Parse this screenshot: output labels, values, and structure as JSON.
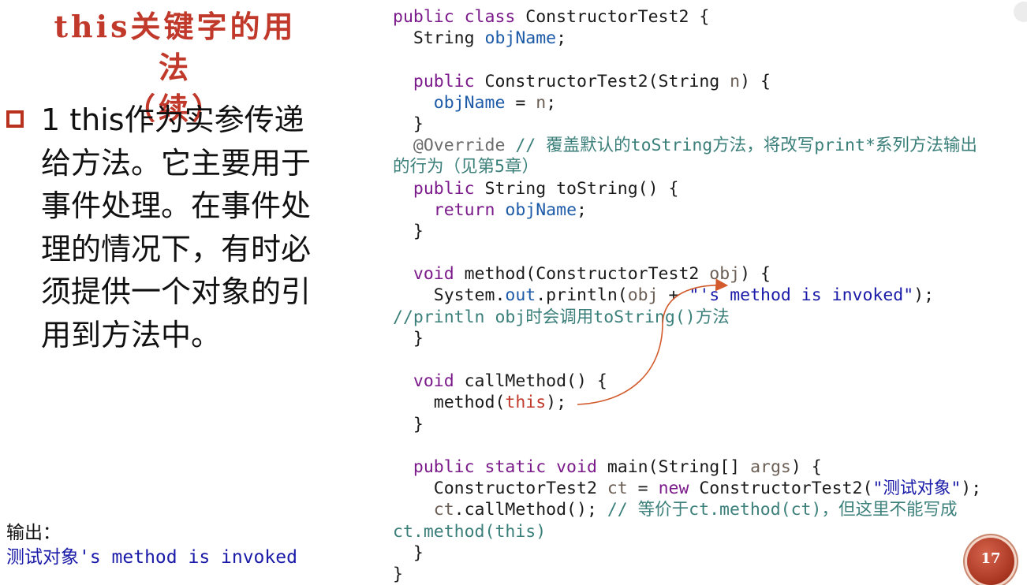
{
  "slide": {
    "title_line1": "this关键字的用法",
    "title_line2": "（续）",
    "bullet_text": "1 this作为实参传递给方法。它主要用于事件处理。在事件处理的情况下，有时必须提供一个对象的引用到方法中。",
    "page_number": "17"
  },
  "code": {
    "lines": {
      "l01": [
        "public class ",
        "ConstructorTest2 {"
      ],
      "l02": [
        "  String ",
        "objName",
        ";"
      ],
      "l04": [
        "  ",
        "public",
        " ConstructorTest2(String ",
        "n",
        ") {"
      ],
      "l05": [
        "    ",
        "objName",
        " = ",
        "n",
        ";"
      ],
      "l06": "  }",
      "l07": [
        "  ",
        "@Override",
        " // 覆盖默认的toString方法，将改写print*系列方法输出"
      ],
      "l08": "的行为（见第5章）",
      "l09": [
        "  ",
        "public",
        " String toString() {"
      ],
      "l10": [
        "    ",
        "return",
        " ",
        "objName",
        ";"
      ],
      "l11": "  }",
      "l13": [
        "  ",
        "void",
        " method(ConstructorTest2 ",
        "obj",
        ") {"
      ],
      "l14": [
        "    System.",
        "out",
        ".println(",
        "obj",
        " + ",
        "\"'s method is invoked\"",
        ");"
      ],
      "l15": "//println obj时会调用toString()方法",
      "l16": "  }",
      "l18": [
        "  ",
        "void",
        " callMethod() {"
      ],
      "l19": [
        "    method(",
        "this",
        ");"
      ],
      "l20": "  }",
      "l22": [
        "  ",
        "public static void",
        " main(String[] ",
        "args",
        ") {"
      ],
      "l23": [
        "    ConstructorTest2 ",
        "ct",
        " = ",
        "new",
        " ConstructorTest2(",
        "\"测试对象\"",
        ");"
      ],
      "l24": [
        "    ",
        "ct",
        ".callMethod(); ",
        "// 等价于ct.method(ct)，但这里不能写成"
      ],
      "l25": "ct.method(this)",
      "l26": "  }",
      "l27": "}"
    }
  },
  "output": {
    "label": "输出：",
    "value": "测试对象's method is invoked"
  },
  "colors": {
    "title": "#c0392b",
    "keyword": "#7b1a8a",
    "comment": "#3b7f7a",
    "string": "#1a1aa8",
    "arrow": "#d25a2c"
  }
}
